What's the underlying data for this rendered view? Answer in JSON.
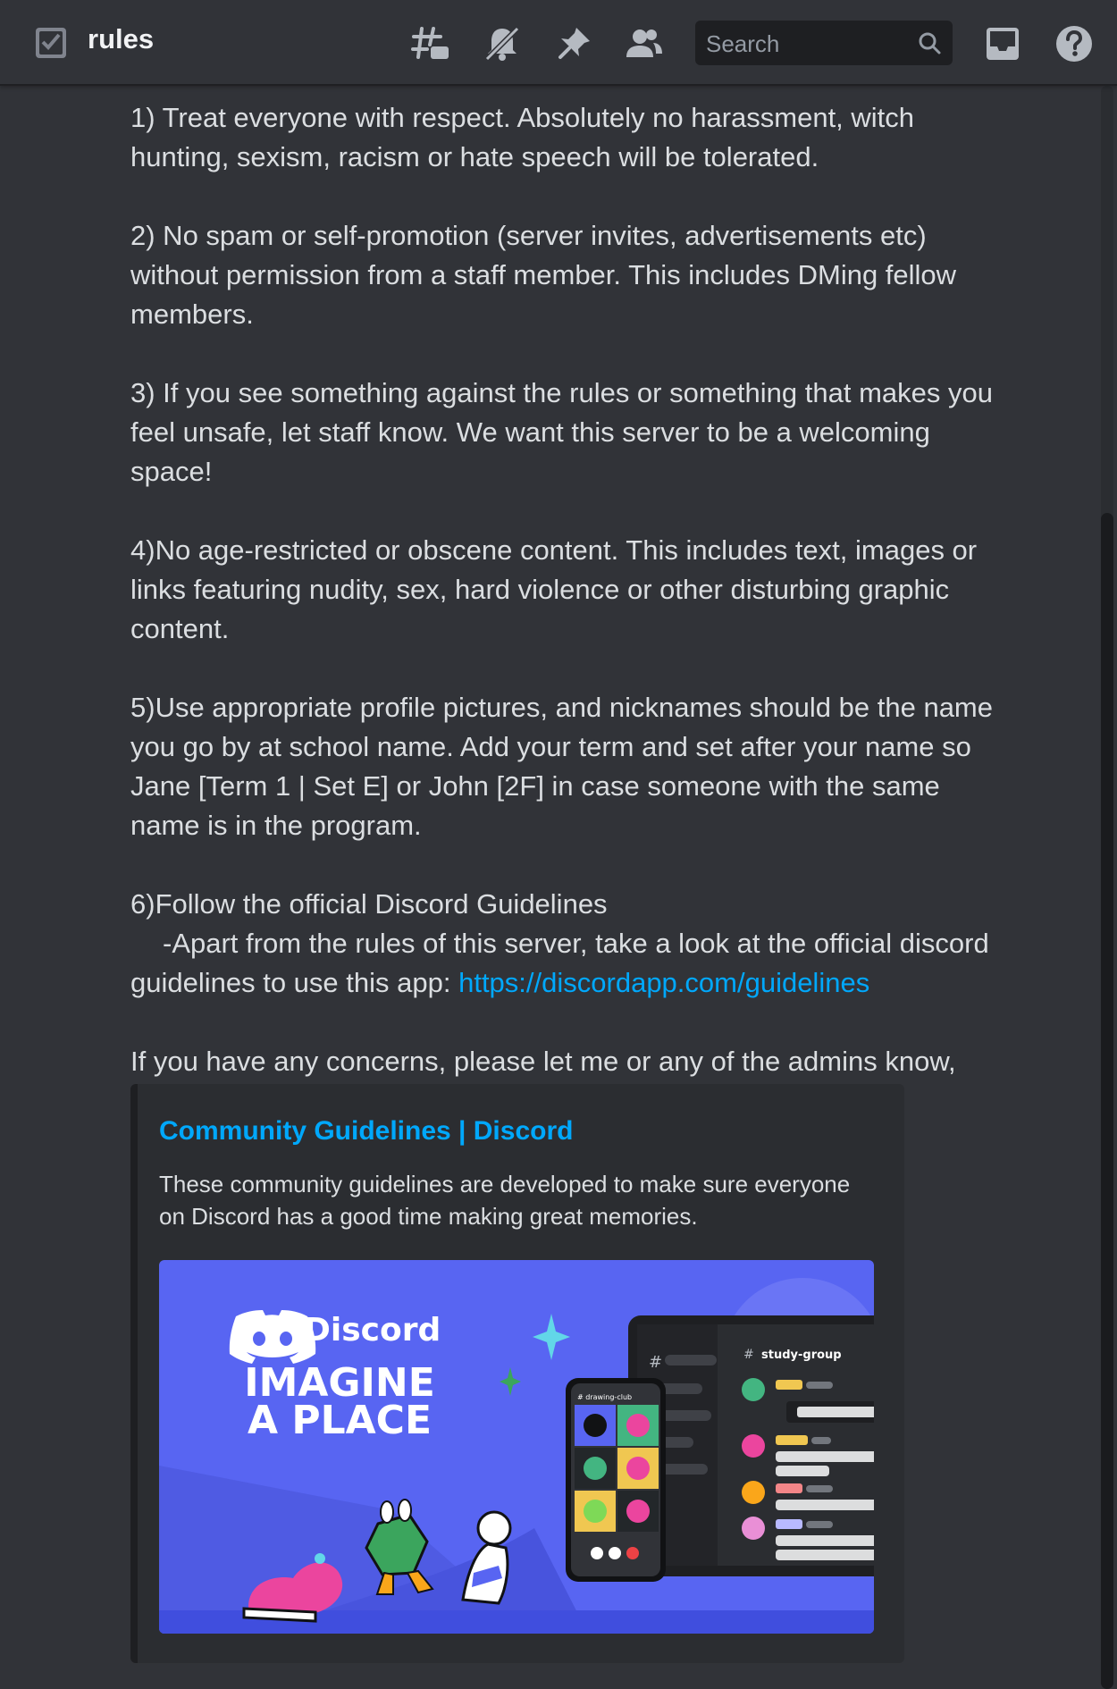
{
  "header": {
    "channel_icon": "checkbox-channel-icon",
    "channel_name": "rules",
    "icons": [
      "threads-icon",
      "mute-bell-icon",
      "pin-icon",
      "members-icon",
      "inbox-icon",
      "help-icon"
    ],
    "search": {
      "placeholder": "Search",
      "icon": "search-icon"
    }
  },
  "message": {
    "paragraphs": [
      "1) Treat everyone with respect. Absolutely no harassment, witch hunting, sexism, racism or hate speech will be tolerated.",
      "2) No spam or self-promotion (server invites, advertisements etc) without permission from a staff member. This includes DMing fellow members.",
      "3) If you see something against the rules or something that makes you feel unsafe, let staff know. We want this server to be a welcoming space!",
      "4)No age-restricted or obscene content. This includes text, images or links featuring nudity, sex, hard violence or other disturbing graphic content.",
      "5)Use appropriate profile pictures, and nicknames should be the name you go by at school name. Add your term and set after your name so Jane [Term 1 | Set E] or John [2F] in case someone with the same name is in the program."
    ],
    "rule6_line1": "6)Follow the official Discord Guidelines",
    "rule6_line2": "-Apart from the rules of this server, take a look at the official discord guidelines to use this app: ",
    "rule6_link": "https://discordapp.com/guidelines",
    "closing": "If you have any concerns, please let me or any of the admins know, we'll be more than happy to assist you!"
  },
  "embed": {
    "title": "Community Guidelines | Discord",
    "description": "These community guidelines are developed to make sure everyone on Discord has a good time making great memories.",
    "image": {
      "brand": "Discord",
      "headline_line1": "IMAGINE",
      "headline_line2": "A PLACE",
      "phone_channel": "# drawing-club",
      "laptop_channel": "study-group"
    }
  },
  "colors": {
    "background": "#313338",
    "text": "#dbdee1",
    "link": "#00a8fc",
    "embed_bg": "#2b2d31",
    "blurple": "#5865f2"
  }
}
